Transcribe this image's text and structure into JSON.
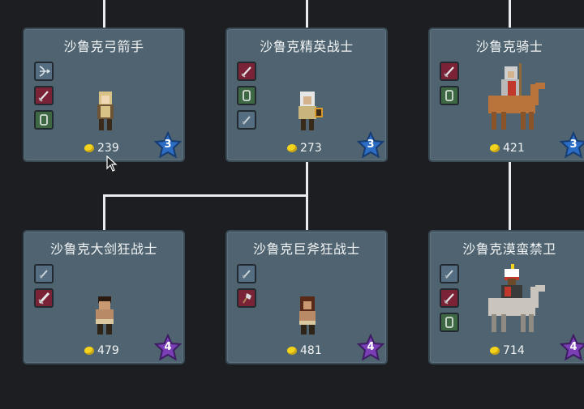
{
  "units": [
    {
      "name": "沙鲁克弓箭手",
      "price": "239",
      "tier": "3",
      "tier_color": "#2b6cc4",
      "slots": [
        {
          "icon": "bow-icon",
          "color": "blue"
        },
        {
          "icon": "sword-icon",
          "color": "red"
        },
        {
          "icon": "shield-icon",
          "color": "green"
        }
      ]
    },
    {
      "name": "沙鲁克精英战士",
      "price": "273",
      "tier": "3",
      "tier_color": "#2b6cc4",
      "slots": [
        {
          "icon": "sword-icon",
          "color": "red"
        },
        {
          "icon": "shield-icon",
          "color": "green"
        },
        {
          "icon": "dagger-icon",
          "color": "blue"
        }
      ]
    },
    {
      "name": "沙鲁克骑士",
      "price": "421",
      "tier": "3",
      "tier_color": "#2b6cc4",
      "slots": [
        {
          "icon": "sword-icon",
          "color": "red"
        },
        {
          "icon": "shield-icon",
          "color": "green"
        }
      ]
    },
    {
      "name": "沙鲁克大剑狂战士",
      "price": "479",
      "tier": "4",
      "tier_color": "#7a3fb5",
      "slots": [
        {
          "icon": "dagger-icon",
          "color": "blue"
        },
        {
          "icon": "greatsword-icon",
          "color": "red"
        }
      ]
    },
    {
      "name": "沙鲁克巨斧狂战士",
      "price": "481",
      "tier": "4",
      "tier_color": "#7a3fb5",
      "slots": [
        {
          "icon": "dagger-icon",
          "color": "blue"
        },
        {
          "icon": "axe-icon",
          "color": "red"
        }
      ]
    },
    {
      "name": "沙鲁克漠蛮禁卫",
      "price": "714",
      "tier": "4",
      "tier_color": "#7a3fb5",
      "slots": [
        {
          "icon": "dagger-icon",
          "color": "blue"
        },
        {
          "icon": "sword-icon",
          "color": "red"
        },
        {
          "icon": "shield-icon",
          "color": "green"
        }
      ]
    }
  ]
}
